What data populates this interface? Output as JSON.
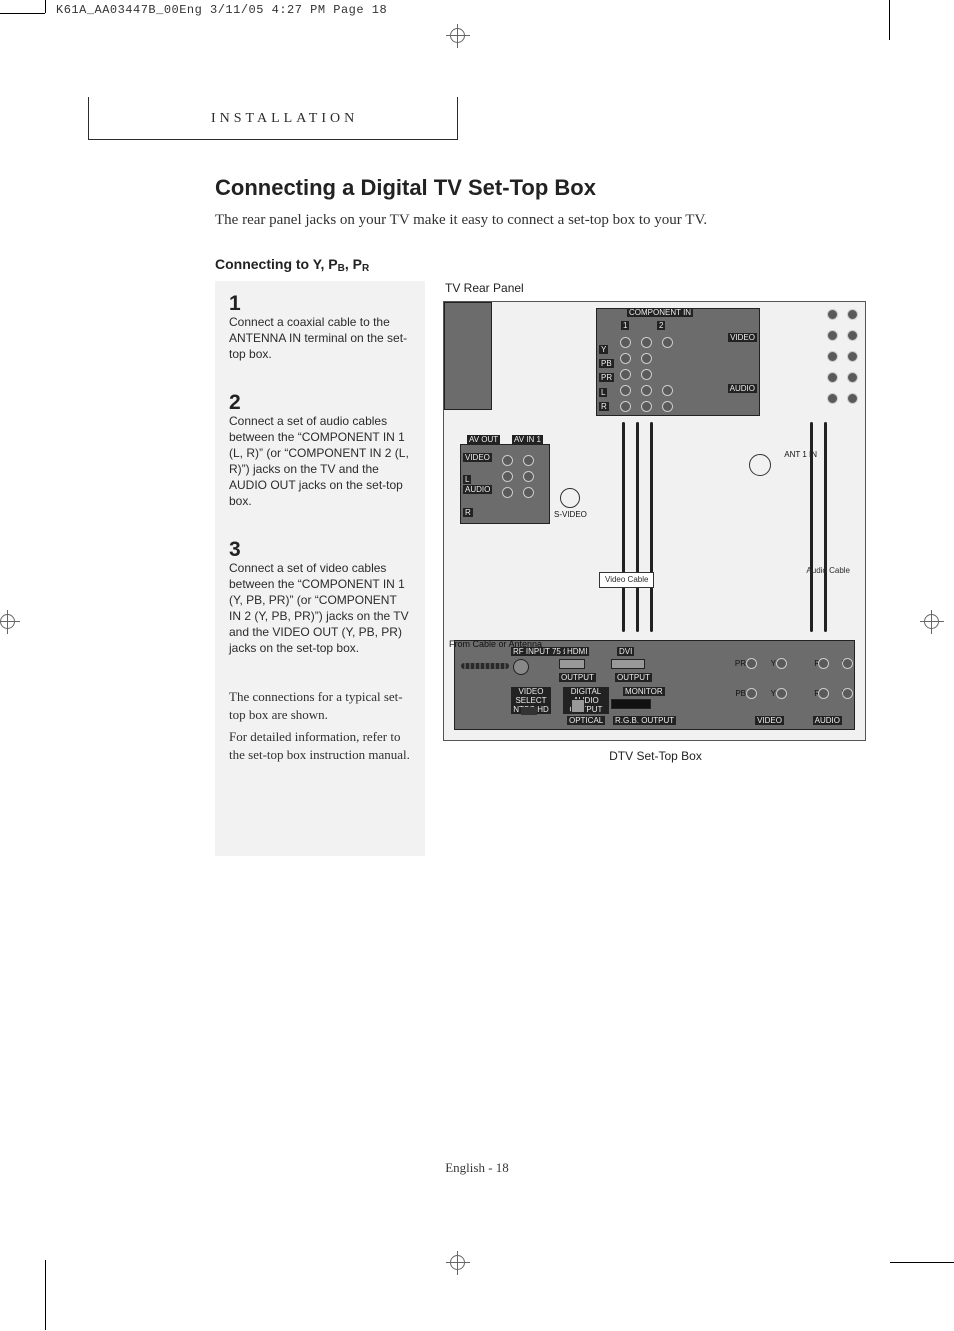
{
  "print_header": "K61A_AA03447B_00Eng  3/11/05  4:27 PM  Page 18",
  "section_tab": "Installation",
  "title": "Connecting a Digital TV Set-Top Box",
  "intro": "The rear panel jacks on your TV make it easy to connect a set-top box to your TV.",
  "subheading_prefix": "Connecting to Y, P",
  "subheading_b": "B",
  "subheading_mid": ", P",
  "subheading_r": "R",
  "steps": [
    {
      "num": "1",
      "text": "Connect a coaxial cable to the ANTENNA IN terminal on the set-top box."
    },
    {
      "num": "2",
      "text": "Connect a set of audio cables between the “COMPONENT IN 1 (L, R)” (or “COMPONENT IN 2 (L, R)”) jacks on the TV and the AUDIO OUT jacks on the set-top box."
    },
    {
      "num": "3",
      "text": "Connect a set of video cables between the “COMPONENT IN 1 (Y, PB, PR)” (or “COMPONENT IN 2 (Y, PB, PR)”) jacks on the TV and the VIDEO OUT (Y, PB, PR) jacks on the set-top box."
    }
  ],
  "note1": "The connections for a typical set-top box are shown.",
  "note2": "For detailed information, refer to the set-top box instruction manual.",
  "diagram": {
    "label_top": "TV Rear Panel",
    "label_bottom": "DTV Set-Top Box",
    "labels": {
      "component_in": "COMPONENT IN",
      "col1": "1",
      "col2": "2",
      "video": "VIDEO",
      "audio": "AUDIO",
      "L": "L",
      "R": "R",
      "av_out": "AV OUT",
      "av_in1": "AV IN 1",
      "svideo": "S-VIDEO",
      "ant1": "ANT 1 IN",
      "video_cable": "Video Cable",
      "audio_cable": "Audio Cable",
      "from_cable": "From Cable or Antenna",
      "rf_input": "RF INPUT 75 Ω",
      "hdmi": "HDMI",
      "dvi": "DVI",
      "output": "OUTPUT",
      "video_select": "VIDEO SELECT NTSC  HD",
      "digital_audio": "DIGITAL AUDIO OUTPUT",
      "optical": "OPTICAL",
      "monitor": "MONITOR",
      "rgb_output": "R.G.B. OUTPUT",
      "Y": "Y",
      "Pb": "PB",
      "Pr": "PR"
    }
  },
  "footer": "English - 18"
}
